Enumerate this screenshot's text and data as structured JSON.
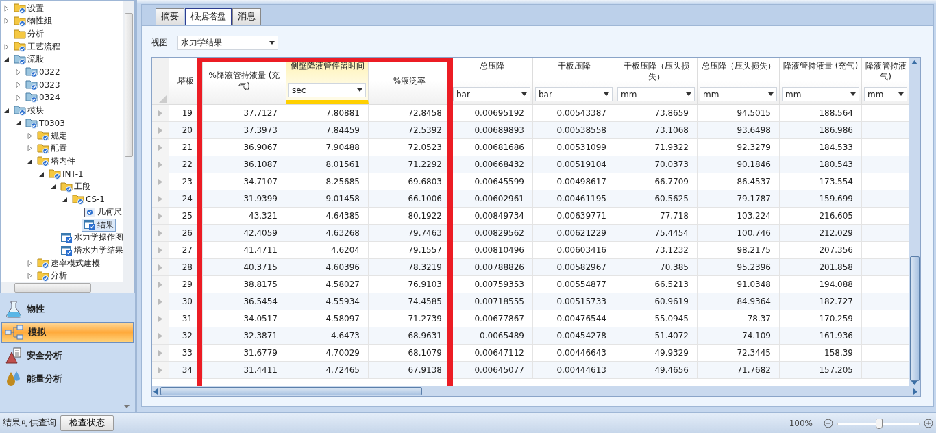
{
  "tree": [
    {
      "label": "设置",
      "kind": "checked-folder",
      "expanded": false,
      "selected": false
    },
    {
      "label": "物性組",
      "kind": "checked-folder",
      "expanded": false,
      "selected": false
    },
    {
      "label": "分析",
      "kind": "folder",
      "selected": false
    },
    {
      "label": "工艺流程",
      "kind": "checked-folder",
      "expanded": false,
      "selected": false
    },
    {
      "label": "流股",
      "kind": "stream-folder",
      "expanded": true,
      "selected": false,
      "children": [
        {
          "label": "0322",
          "kind": "stream-folder",
          "expanded": false,
          "selected": false
        },
        {
          "label": "0323",
          "kind": "stream-folder",
          "expanded": false,
          "selected": false
        },
        {
          "label": "0324",
          "kind": "stream-folder",
          "expanded": false,
          "selected": false
        }
      ]
    },
    {
      "label": "模块",
      "kind": "stream-folder",
      "expanded": true,
      "selected": false,
      "children": [
        {
          "label": "T0303",
          "kind": "stream-folder",
          "expanded": true,
          "selected": false,
          "children": [
            {
              "label": "规定",
              "kind": "checked-folder",
              "expanded": false,
              "selected": false
            },
            {
              "label": "配置",
              "kind": "checked-folder",
              "expanded": false,
              "selected": false
            },
            {
              "label": "塔内件",
              "kind": "checked-folder",
              "expanded": true,
              "selected": false,
              "children": [
                {
                  "label": "INT-1",
                  "kind": "checked-folder",
                  "expanded": true,
                  "selected": false,
                  "children": [
                    {
                      "label": "工段",
                      "kind": "checked-folder",
                      "expanded": true,
                      "selected": false,
                      "children": [
                        {
                          "label": "CS-1",
                          "kind": "checked-folder",
                          "expanded": true,
                          "selected": false,
                          "children": [
                            {
                              "label": "几何尺",
                              "kind": "form",
                              "selected": false
                            },
                            {
                              "label": "结果",
                              "kind": "sheet",
                              "selected": true
                            }
                          ]
                        }
                      ]
                    },
                    {
                      "label": "水力学操作图",
                      "kind": "sheet",
                      "selected": false
                    },
                    {
                      "label": "塔水力学结果",
                      "kind": "sheet",
                      "selected": false
                    }
                  ]
                }
              ]
            },
            {
              "label": "速率模式建模",
              "kind": "checked-folder",
              "expanded": false,
              "selected": false
            },
            {
              "label": "分析",
              "kind": "checked-folder",
              "expanded": false,
              "selected": false
            }
          ]
        }
      ]
    }
  ],
  "nav": [
    {
      "label": "物性",
      "kind": "flask",
      "selected": false
    },
    {
      "label": "模拟",
      "kind": "flowsheet",
      "selected": true
    },
    {
      "label": "安全分析",
      "kind": "safety",
      "selected": false
    },
    {
      "label": "能量分析",
      "kind": "energy",
      "selected": false
    }
  ],
  "tabs": [
    {
      "label": "摘要",
      "selected": false
    },
    {
      "label": "根据塔盘",
      "selected": true
    },
    {
      "label": "消息",
      "selected": false
    }
  ],
  "view": {
    "label": "视图",
    "value": "水力学结果"
  },
  "columns": [
    {
      "label": "塔板",
      "selected": false,
      "highlighted": false
    },
    {
      "label": "%降液管持液量 (充气)",
      "selected": false,
      "highlighted": true
    },
    {
      "label": "侧壁降液管停留时间",
      "unit": "sec",
      "selected": true,
      "highlighted": true
    },
    {
      "label": "%液泛率",
      "selected": false,
      "highlighted": true
    },
    {
      "label": "总压降",
      "unit": "bar",
      "selected": false,
      "highlighted": false
    },
    {
      "label": "干板压降",
      "unit": "bar",
      "selected": false,
      "highlighted": false
    },
    {
      "label": "干板压降（压头损失）",
      "unit": "mm",
      "selected": false,
      "highlighted": false
    },
    {
      "label": "总压降（压头损失）",
      "unit": "mm",
      "selected": false,
      "highlighted": false
    },
    {
      "label": "降液管持液量 (充气)",
      "unit": "mm",
      "selected": false,
      "highlighted": false
    },
    {
      "label": "降液管持液气)",
      "unit": "mm",
      "selected": false,
      "highlighted": false
    }
  ],
  "rows": [
    [
      "19",
      "37.7127",
      "7.80881",
      "72.8458",
      "0.00695192",
      "0.00543387",
      "73.8659",
      "94.5015",
      "188.564"
    ],
    [
      "20",
      "37.3973",
      "7.84459",
      "72.5392",
      "0.00689893",
      "0.00538558",
      "73.1068",
      "93.6498",
      "186.986"
    ],
    [
      "21",
      "36.9067",
      "7.90488",
      "72.0523",
      "0.00681686",
      "0.00531099",
      "71.9322",
      "92.3279",
      "184.533"
    ],
    [
      "22",
      "36.1087",
      "8.01561",
      "71.2292",
      "0.00668432",
      "0.00519104",
      "70.0373",
      "90.1846",
      "180.543"
    ],
    [
      "23",
      "34.7107",
      "8.25685",
      "69.6803",
      "0.00645599",
      "0.00498617",
      "66.7709",
      "86.4537",
      "173.554"
    ],
    [
      "24",
      "31.9399",
      "9.01458",
      "66.1006",
      "0.00602961",
      "0.00461195",
      "60.5625",
      "79.1787",
      "159.699"
    ],
    [
      "25",
      "43.321",
      "4.64385",
      "80.1922",
      "0.00849734",
      "0.00639771",
      "77.718",
      "103.224",
      "216.605"
    ],
    [
      "26",
      "42.4059",
      "4.63268",
      "79.7463",
      "0.00829562",
      "0.00621229",
      "75.4454",
      "100.746",
      "212.029"
    ],
    [
      "27",
      "41.4711",
      "4.6204",
      "79.1557",
      "0.00810496",
      "0.00603416",
      "73.1232",
      "98.2175",
      "207.356"
    ],
    [
      "28",
      "40.3715",
      "4.60396",
      "78.3219",
      "0.00788826",
      "0.00582967",
      "70.385",
      "95.2396",
      "201.858"
    ],
    [
      "29",
      "38.8175",
      "4.58027",
      "76.9103",
      "0.00759353",
      "0.00554877",
      "66.5213",
      "91.0348",
      "194.088"
    ],
    [
      "30",
      "36.5454",
      "4.55934",
      "74.4585",
      "0.00718555",
      "0.00515733",
      "60.9619",
      "84.9364",
      "182.727"
    ],
    [
      "31",
      "34.0517",
      "4.58097",
      "71.2739",
      "0.00677867",
      "0.00476544",
      "55.0945",
      "78.37",
      "170.259"
    ],
    [
      "32",
      "32.3871",
      "4.6473",
      "68.9631",
      "0.0065489",
      "0.00454278",
      "51.4072",
      "74.109",
      "161.936"
    ],
    [
      "33",
      "31.6779",
      "4.70029",
      "68.1079",
      "0.00647112",
      "0.00446643",
      "49.9329",
      "72.3445",
      "158.39"
    ],
    [
      "34",
      "31.4411",
      "4.72465",
      "67.9138",
      "0.00645077",
      "0.00444613",
      "49.4656",
      "71.7682",
      "157.205"
    ]
  ],
  "status": {
    "message": "结果可供查询",
    "button": "检查状态",
    "zoom": "100%",
    "level": 0.5
  }
}
